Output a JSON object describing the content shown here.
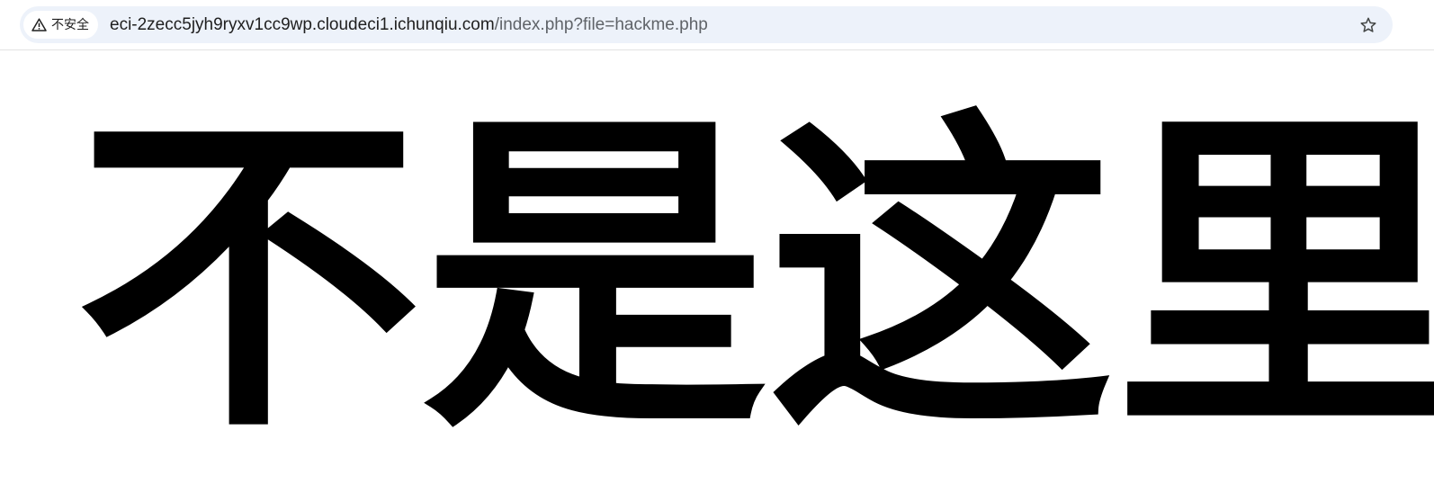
{
  "address_bar": {
    "security_label": "不安全",
    "security_icon": "warning-triangle-icon",
    "url_host": "eci-2zecc5jyh9ryxv1cc9wp.cloudeci1.ichunqiu.com",
    "url_path": "/index.php?file=hackme.php",
    "bookmark_icon": "star-outline-icon"
  },
  "page": {
    "heading": "不是这里"
  },
  "colors": {
    "omnibox_bg": "#edf2fa",
    "text": "#000000",
    "url_path": "#5f6368"
  }
}
